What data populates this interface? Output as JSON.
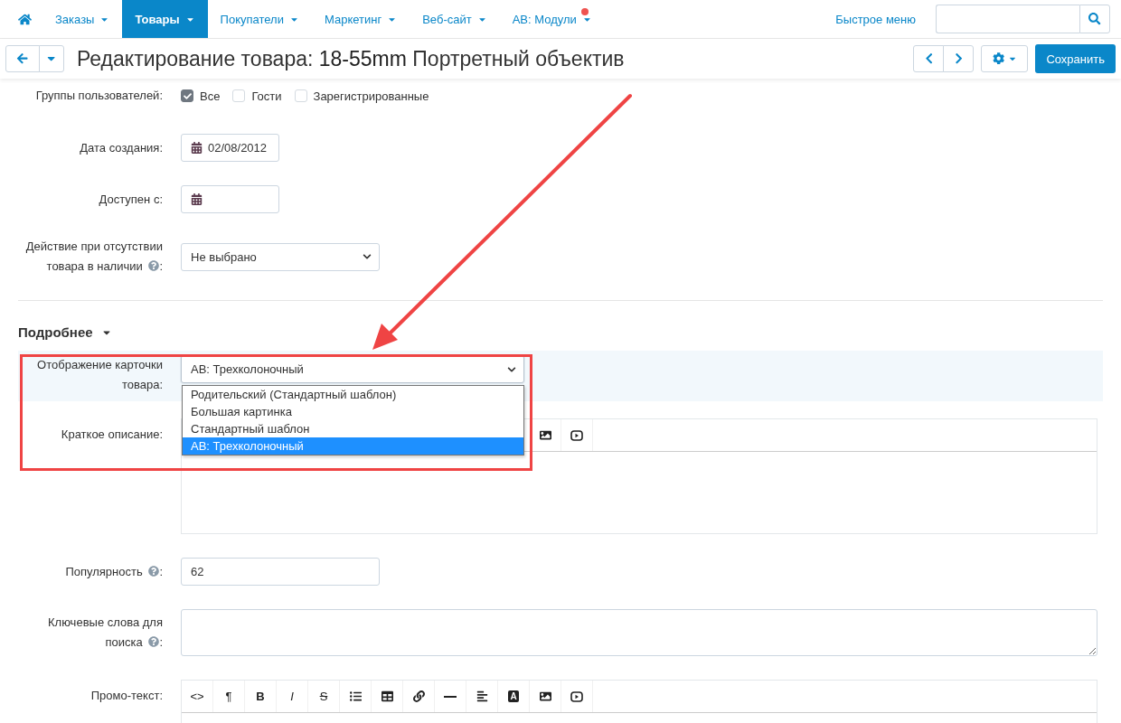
{
  "nav": {
    "items": [
      {
        "label": "Заказы",
        "selected": false,
        "notification": false
      },
      {
        "label": "Товары",
        "selected": true,
        "notification": false
      },
      {
        "label": "Покупатели",
        "selected": false,
        "notification": false
      },
      {
        "label": "Маркетинг",
        "selected": false,
        "notification": false
      },
      {
        "label": "Веб-сайт",
        "selected": false,
        "notification": false
      },
      {
        "label": "АВ: Модули",
        "selected": false,
        "notification": true
      }
    ],
    "quick_menu": "Быстрое меню"
  },
  "header": {
    "title_prefix": "Редактирование товара:",
    "title_product": "18-55mm",
    "title_rest": "Портретный объектив",
    "save_button": "Сохранить"
  },
  "fields": [
    {
      "kind": "checkboxes",
      "label": "Группы пользователей:",
      "options": [
        {
          "label": "Все",
          "checked": true
        },
        {
          "label": "Гости",
          "checked": false
        },
        {
          "label": "Зарегистрированные",
          "checked": false
        }
      ]
    },
    {
      "kind": "date",
      "label": "Дата создания:",
      "value": "02/08/2012"
    },
    {
      "kind": "date",
      "label": "Доступен с:"
    },
    {
      "kind": "select",
      "label": "Действие при отсутствии товара в наличии",
      "help": true,
      "label_end": ":",
      "value": "Не выбрано",
      "highlighted": false
    }
  ],
  "section": {
    "title": "Подробнее",
    "expanded": true,
    "fields": [
      {
        "kind": "select",
        "label": "Отображение карточки товара:",
        "value": "АВ: Трехколоночный",
        "open": true,
        "highlighted": true,
        "wide": true,
        "options": [
          {
            "label": "Родительский (Стандартный шаблон)",
            "selected": false
          },
          {
            "label": "Большая картинка",
            "selected": false
          },
          {
            "label": "Стандартный шаблон",
            "selected": false
          },
          {
            "label": "АВ: Трехколоночный",
            "selected": true
          }
        ]
      },
      {
        "kind": "editor",
        "label": "Краткое описание:",
        "tools": [
          {
            "kind": "image"
          },
          {
            "kind": "video"
          }
        ]
      },
      {
        "kind": "text",
        "label": "Популярность",
        "help": true,
        "label_end": ":",
        "value": "62"
      },
      {
        "kind": "textarea",
        "label": "Ключевые слова для поиска",
        "help": true,
        "label_end": ":"
      },
      {
        "kind": "editor",
        "label": "Промо-текст:",
        "tools": [
          {
            "kind": "glyph",
            "label": "<>"
          },
          {
            "kind": "glyph",
            "label": "¶"
          },
          {
            "kind": "bold",
            "label": "B"
          },
          {
            "kind": "italic",
            "label": "I"
          },
          {
            "kind": "strike",
            "label": "S"
          },
          {
            "kind": "list"
          },
          {
            "kind": "table"
          },
          {
            "kind": "link"
          },
          {
            "kind": "rule"
          },
          {
            "kind": "align"
          },
          {
            "kind": "color",
            "label": "A"
          },
          {
            "kind": "image"
          },
          {
            "kind": "video"
          }
        ]
      }
    ]
  },
  "annotation": {
    "arrow": true,
    "frame": true
  }
}
